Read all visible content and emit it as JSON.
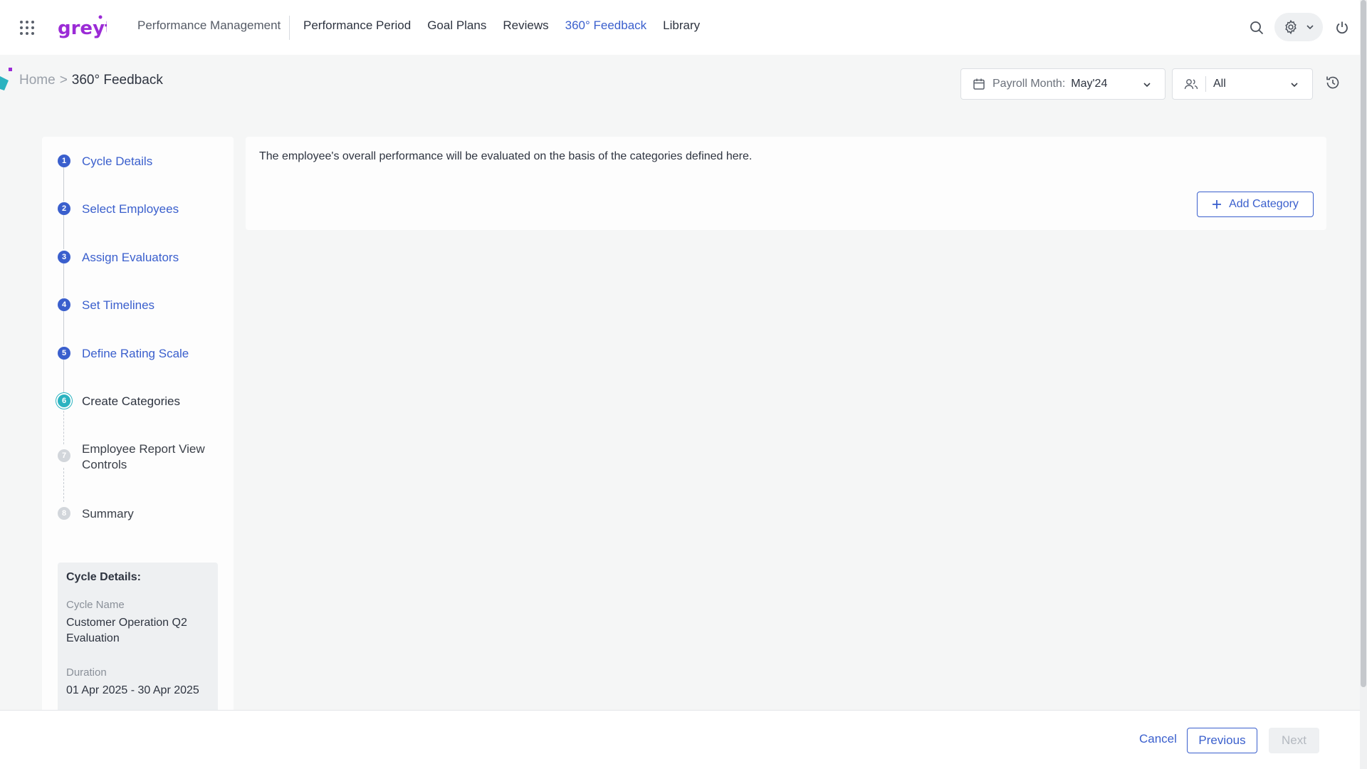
{
  "header": {
    "module_title": "Performance Management",
    "nav": [
      {
        "label": "Performance Period"
      },
      {
        "label": "Goal Plans"
      },
      {
        "label": "Reviews"
      },
      {
        "label": "360° Feedback",
        "active": true
      },
      {
        "label": "Library"
      }
    ],
    "logo_text": "greyt"
  },
  "breadcrumb": {
    "home": "Home",
    "separator": ">",
    "current": "360° Feedback"
  },
  "filters": {
    "payroll_label": "Payroll Month:",
    "payroll_value": "May'24",
    "group_value": "All"
  },
  "stepper": {
    "steps": [
      {
        "num": "1",
        "label": "Cycle Details",
        "state": "done"
      },
      {
        "num": "2",
        "label": "Select Employees",
        "state": "done"
      },
      {
        "num": "3",
        "label": "Assign Evaluators",
        "state": "done"
      },
      {
        "num": "4",
        "label": "Set Timelines",
        "state": "done"
      },
      {
        "num": "5",
        "label": "Define Rating Scale",
        "state": "done"
      },
      {
        "num": "6",
        "label": "Create Categories",
        "state": "current"
      },
      {
        "num": "7",
        "label": "Employee Report View Controls",
        "state": "pending"
      },
      {
        "num": "8",
        "label": "Summary",
        "state": "pending"
      }
    ],
    "cycle_details": {
      "title": "Cycle Details:",
      "name_label": "Cycle Name",
      "name_value": "Customer Operation Q2 Evaluation",
      "duration_label": "Duration",
      "duration_value": "01 Apr 2025 - 30 Apr 2025"
    }
  },
  "main": {
    "description": "The employee's overall performance will be evaluated on the basis of the categories defined here.",
    "add_category_label": "Add Category"
  },
  "footer": {
    "cancel_label": "Cancel",
    "previous_label": "Previous",
    "next_label": "Next"
  },
  "colors": {
    "accent": "#3a5fcd",
    "current_step": "#2bb3c0",
    "logo": "#9b2bd6"
  }
}
